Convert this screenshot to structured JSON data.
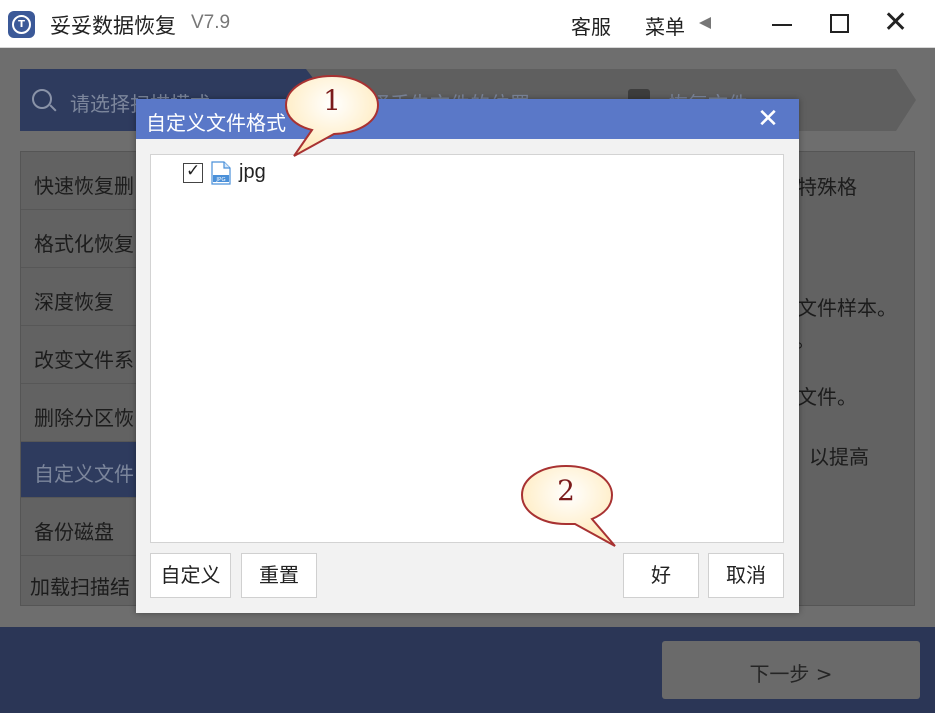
{
  "titlebar": {
    "app_name": "妥妥数据恢复",
    "version": "V7.9",
    "support": "客服",
    "menu": "菜单",
    "icon_letters": "T"
  },
  "steps": [
    {
      "label": "请选择扫描模式"
    },
    {
      "label": "选择丢失文件的位置"
    },
    {
      "label": "恢复文件"
    }
  ],
  "sidebar": {
    "items": [
      {
        "label": "快速恢复删"
      },
      {
        "label": "格式化恢复"
      },
      {
        "label": "深度恢复"
      },
      {
        "label": "改变文件系"
      },
      {
        "label": "删除分区恢"
      },
      {
        "label": "自定义文件"
      },
      {
        "label": "备份磁盘"
      },
      {
        "label": "加载扫描结"
      }
    ]
  },
  "right_panel": {
    "lines": [
      "特殊格",
      "文件样本。",
      "。",
      "文件。",
      "，以提高"
    ]
  },
  "footer": {
    "next_label": "下一步 >"
  },
  "dialog": {
    "title": "自定义文件格式",
    "list": [
      {
        "name": "jpg",
        "checked": true,
        "icon": "jpg-file-icon",
        "icon_text": "JPG"
      }
    ],
    "buttons": {
      "customize": "自定义",
      "reset": "重置",
      "ok": "好",
      "cancel": "取消"
    }
  },
  "callouts": [
    {
      "number": "1"
    },
    {
      "number": "2"
    }
  ],
  "colors": {
    "dialog_title_bg": "#5a78c8",
    "active_blue": "#2e3b5e",
    "callout_fill": "#fff5d6",
    "callout_stroke": "#a83232"
  }
}
